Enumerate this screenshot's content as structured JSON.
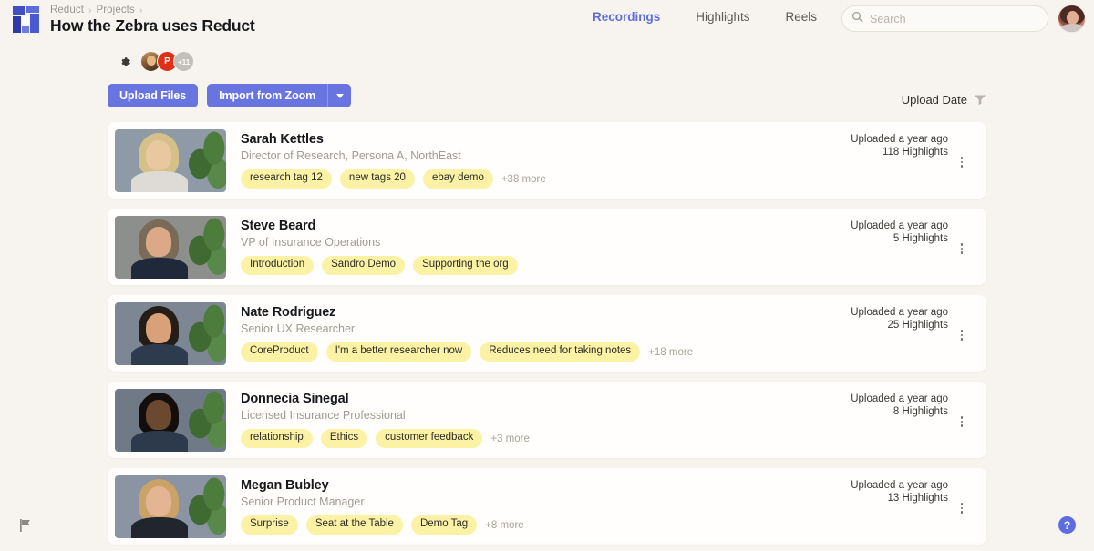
{
  "app": {
    "logo_name": "reduct-logo",
    "background_color": "#f7f4ef",
    "accent_color": "#6874e0",
    "tag_color": "#fbf2a6"
  },
  "header": {
    "breadcrumb": [
      "Reduct",
      "Projects"
    ],
    "separator": "›",
    "title": "How the Zebra uses Reduct",
    "nav": [
      {
        "label": "Recordings",
        "active": true
      },
      {
        "label": "Highlights",
        "active": false
      },
      {
        "label": "Reels",
        "active": false
      }
    ],
    "search": {
      "placeholder": "Search",
      "value": ""
    },
    "profile_avatar_label": ""
  },
  "toolbar": {
    "settings_icon": "gear-icon",
    "avatars": [
      {
        "type": "photo",
        "label": ""
      },
      {
        "type": "initial",
        "label": "P",
        "color": "#df3017"
      },
      {
        "type": "overflow",
        "label": "+11",
        "color": "#c3c0bb"
      }
    ],
    "upload_files_label": "Upload Files",
    "import_from_zoom_label": "Import from Zoom",
    "import_dropdown_icon": "chevron-down-icon",
    "sort_label": "Upload Date",
    "sort_icon": "sort-filter-icon"
  },
  "recordings": [
    {
      "name": "Sarah Kettles",
      "role": "Director of Research, Persona A, NorthEast",
      "tags": [
        "research tag 12",
        "new tags 20",
        "ebay demo"
      ],
      "more_tags": "+38 more",
      "uploaded": "Uploaded a year ago",
      "highlights": "118 Highlights",
      "thumb": {
        "skin": "#e8c89f",
        "hair": "#d6c08a",
        "shirt": "#dedbd6",
        "bg": "#8e9aa6"
      }
    },
    {
      "name": "Steve Beard",
      "role": "VP of Insurance Operations",
      "tags": [
        "Introduction",
        "Sandro Demo",
        "Supporting the org"
      ],
      "more_tags": "",
      "uploaded": "Uploaded a year ago",
      "highlights": "5 Highlights",
      "thumb": {
        "skin": "#dba987",
        "hair": "#7a6a58",
        "shirt": "#20293a",
        "bg": "#8d8f8d"
      }
    },
    {
      "name": "Nate Rodriguez",
      "role": "Senior UX Researcher",
      "tags": [
        "CoreProduct",
        "I'm a better researcher now",
        "Reduces need for taking notes"
      ],
      "more_tags": "+18 more",
      "uploaded": "Uploaded a year ago",
      "highlights": "25 Highlights",
      "thumb": {
        "skin": "#d9a179",
        "hair": "#241c17",
        "shirt": "#2e3b4e",
        "bg": "#7d8794"
      }
    },
    {
      "name": "Donnecia Sinegal",
      "role": "Licensed Insurance Professional",
      "tags": [
        "relationship",
        "Ethics",
        "customer feedback"
      ],
      "more_tags": "+3 more",
      "uploaded": "Uploaded a year ago",
      "highlights": "8 Highlights",
      "thumb": {
        "skin": "#6b4830",
        "hair": "#130e0b",
        "shirt": "#2c3a4c",
        "bg": "#6f7a86"
      }
    },
    {
      "name": "Megan Bubley",
      "role": "Senior Product Manager",
      "tags": [
        "Surprise",
        "Seat at the Table",
        "Demo Tag"
      ],
      "more_tags": "+8 more",
      "uploaded": "Uploaded a year ago",
      "highlights": "13 Highlights",
      "thumb": {
        "skin": "#e3b592",
        "hair": "#c9a367",
        "shirt": "#21252e",
        "bg": "#8b94a3"
      }
    }
  ],
  "floating": {
    "flag_icon": "flag-icon",
    "help_label": "?"
  }
}
